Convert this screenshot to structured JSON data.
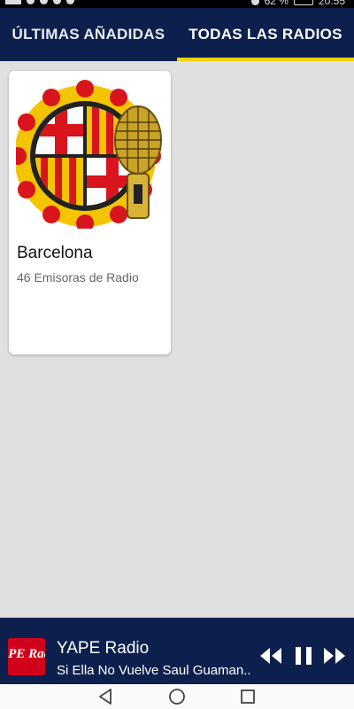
{
  "status_bar": {
    "battery": "62 %",
    "time": "20:55"
  },
  "tabs": [
    {
      "label": "ÚLTIMAS AÑADIDAS",
      "active": false
    },
    {
      "label": "TODAS LAS RADIOS",
      "active": true
    }
  ],
  "colors": {
    "app_bar": "#0d1f4d",
    "tab_indicator": "#f0d200",
    "background": "#e0e0e0",
    "logo_red": "#d0021b"
  },
  "cards": [
    {
      "title": "Barcelona",
      "subtitle": "46 Emisoras de Radio",
      "image_icon": "barcelona-flag-microphone-icon"
    }
  ],
  "player": {
    "station": "YAPE Radio",
    "track": "Si Ella  No Vuelve  Saul Guaman..",
    "logo_icon": "yape-radio-logo",
    "logo_text": "YAPE Radio",
    "controls": [
      "rewind-icon",
      "pause-icon",
      "fast-forward-icon"
    ]
  },
  "nav": [
    "back-icon",
    "home-icon",
    "recents-icon"
  ]
}
